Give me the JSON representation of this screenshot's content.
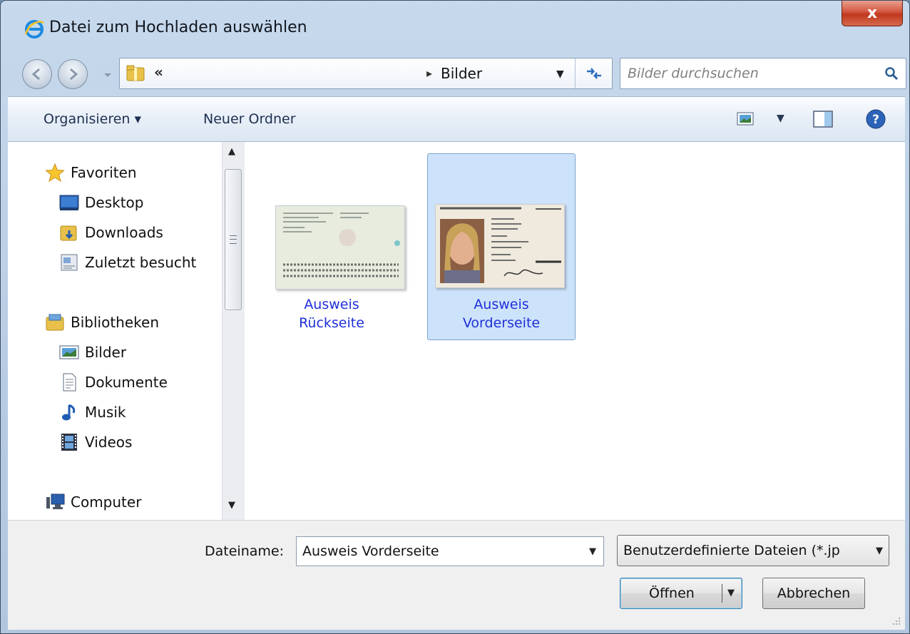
{
  "window": {
    "title": "Datei zum Hochladen auswählen",
    "close_label": "x"
  },
  "address": {
    "overflow": "«",
    "crumb": "Bilder"
  },
  "search": {
    "placeholder": "Bilder durchsuchen"
  },
  "toolbar": {
    "organize_label": "Organisieren ▾",
    "new_folder_label": "Neuer Ordner"
  },
  "sidebar": {
    "favorites": "Favoriten",
    "desktop": "Desktop",
    "downloads": "Downloads",
    "recent": "Zuletzt besucht",
    "libraries": "Bibliotheken",
    "pictures": "Bilder",
    "documents": "Dokumente",
    "music": "Musik",
    "videos": "Videos",
    "computer": "Computer"
  },
  "files": [
    {
      "line1": "Ausweis",
      "line2": "Rückseite",
      "selected": false
    },
    {
      "line1": "Ausweis",
      "line2": "Vorderseite",
      "selected": true
    }
  ],
  "footer": {
    "filename_label": "Dateiname:",
    "filename_value": "Ausweis Vorderseite",
    "filetype_value": "Benutzerdefinierte Dateien (*.jp",
    "open_label": "Öffnen",
    "cancel_label": "Abbrechen"
  },
  "colors": {
    "selection": "#cde3fb",
    "link_text": "#1f2fd9",
    "close_red": "#c0371e"
  }
}
